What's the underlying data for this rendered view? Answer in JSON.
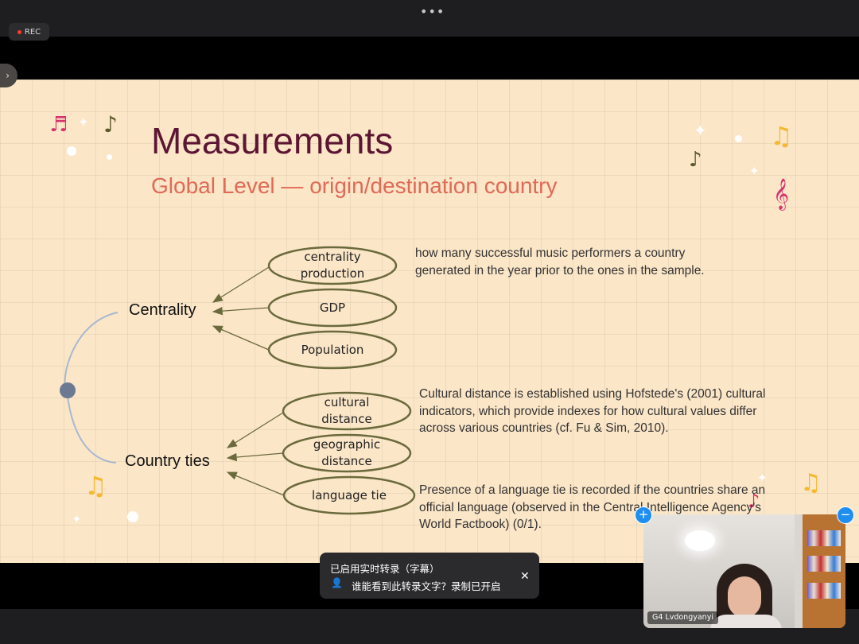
{
  "app": {
    "rec_label": "REC",
    "more_icon": "more-dots-icon",
    "side_icon": "chevron-right-icon"
  },
  "slide": {
    "title": "Measurements",
    "subtitle": "Global Level — origin/destination country",
    "centrality": {
      "label": "Centrality",
      "nodes": [
        [
          "centrality",
          "production"
        ],
        [
          "GDP"
        ],
        [
          "Population"
        ]
      ],
      "description": [
        "how many successful music performers a country",
        "generated in the year prior to the ones in the sample."
      ]
    },
    "country_ties": {
      "label": "Country ties",
      "nodes": [
        [
          "cultural",
          "distance"
        ],
        [
          "geographic",
          "distance"
        ],
        [
          "language tie"
        ]
      ],
      "descriptions": [
        [
          "Cultural distance is established using Hofstede's (2001) cultural",
          "indicators, which provide indexes for how cultural values differ",
          "across various countries (cf. Fu & Sim, 2010)."
        ],
        [
          "Presence of a language tie is recorded if the countries share an",
          "official language (observed in the Central Intelligence Agency's",
          "World Factbook) (0/1)."
        ]
      ]
    },
    "colors": {
      "background": "#fbe6c8",
      "title": "#5c1533",
      "subtitle": "#e06a56",
      "node_stroke": "#6b6a3c",
      "arc": "#a9b8cf",
      "hub": "#6b7a92"
    }
  },
  "caption_bar": {
    "line1": "已启用实时转录（字幕）",
    "line2": "谁能看到此转录文字？录制已开启",
    "close_icon": "close-icon"
  },
  "video": {
    "participant_name": "G4 Lvdongyanyi",
    "add_icon": "plus-icon",
    "minimize_icon": "minus-icon"
  }
}
